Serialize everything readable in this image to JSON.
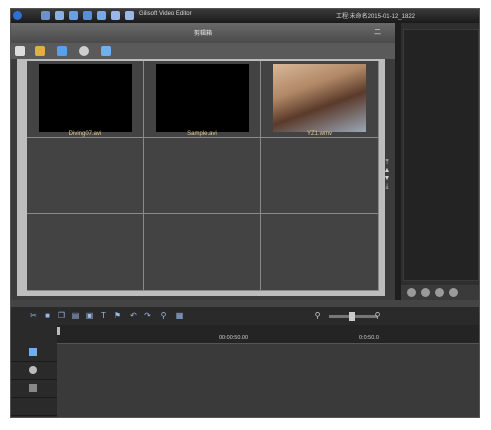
{
  "app": {
    "title": "Gilisoft Video Editor",
    "project_info": "工程:未命名2015-01-12_1822"
  },
  "library": {
    "title": "剪辑箱",
    "toggle_label": "二",
    "items": [
      {
        "name": "Diving07.avi",
        "thumb": "black"
      },
      {
        "name": "Sample.avi",
        "thumb": "black"
      },
      {
        "name": "YZ1.wmv",
        "thumb": "photo"
      }
    ]
  },
  "timeline": {
    "marker_time": "00:00:50.00",
    "tick_time": "0:0:50.0"
  },
  "colors": {
    "accent": "#9ab7e8",
    "label": "#e0c890",
    "panel": "#3c3c3c"
  },
  "icons": [
    "windows-logo-icon",
    "cut-icon",
    "delete-icon",
    "zoom-out-icon",
    "zoom-in-icon",
    "video-track-icon",
    "audio-track-icon",
    "music-track-icon",
    "play-icon"
  ]
}
